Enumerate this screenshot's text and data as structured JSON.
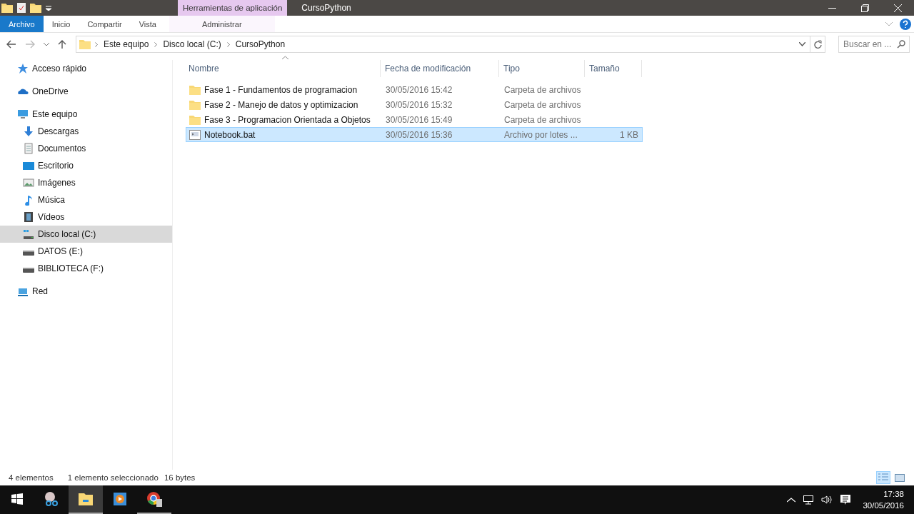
{
  "title_bar": {
    "contextual_tab": "Herramientas de aplicación",
    "title": "CursoPython"
  },
  "ribbon_tabs": [
    {
      "label": "Archivo",
      "kind": "file"
    },
    {
      "label": "Inicio",
      "kind": "normal"
    },
    {
      "label": "Compartir",
      "kind": "normal"
    },
    {
      "label": "Vista",
      "kind": "normal"
    },
    {
      "label": "Administrar",
      "kind": "contextual"
    }
  ],
  "address_bar": {
    "breadcrumbs": [
      "Este equipo",
      "Disco local (C:)",
      "CursoPython"
    ]
  },
  "search": {
    "placeholder": "Buscar en ..."
  },
  "sidebar": {
    "items": [
      {
        "label": "Acceso rápido",
        "kind": "star",
        "selected": false
      },
      {
        "label": "OneDrive",
        "kind": "cloud",
        "selected": false
      },
      {
        "label": "Este equipo",
        "kind": "pc",
        "selected": false,
        "children": [
          {
            "label": "Descargas",
            "kind": "download",
            "selected": false
          },
          {
            "label": "Documentos",
            "kind": "document",
            "selected": false
          },
          {
            "label": "Escritorio",
            "kind": "desktop",
            "selected": false
          },
          {
            "label": "Imágenes",
            "kind": "image",
            "selected": false
          },
          {
            "label": "Música",
            "kind": "music",
            "selected": false
          },
          {
            "label": "Vídeos",
            "kind": "video",
            "selected": false
          },
          {
            "label": "Disco local (C:)",
            "kind": "windrive",
            "selected": true
          },
          {
            "label": "DATOS (E:)",
            "kind": "drive",
            "selected": false
          },
          {
            "label": "BIBLIOTECA (F:)",
            "kind": "drive",
            "selected": false
          }
        ]
      },
      {
        "label": "Red",
        "kind": "network",
        "selected": false
      }
    ]
  },
  "table": {
    "columns": [
      {
        "label": "Nombre",
        "sorted": true
      },
      {
        "label": "Fecha de modificación",
        "sorted": false
      },
      {
        "label": "Tipo",
        "sorted": false
      },
      {
        "label": "Tamaño",
        "sorted": false
      }
    ],
    "rows": [
      {
        "name": "Fase 1 - Fundamentos de programacion",
        "date": "30/05/2016 15:42",
        "type": "Carpeta de archivos",
        "kind": "folder",
        "selected": false
      },
      {
        "name": "Fase 2 - Manejo de datos y optimizacion",
        "date": "30/05/2016 15:32",
        "type": "Carpeta de archivos",
        "kind": "folder",
        "selected": false
      },
      {
        "name": "Fase 3 - Programacion Orientada a Objetos",
        "date": "30/05/2016 15:49",
        "type": "Carpeta de archivos",
        "kind": "folder",
        "selected": false
      },
      {
        "name": "Notebook.bat",
        "date": "30/05/2016 15:36",
        "type": "Archivo por lotes ...",
        "size": "1 KB",
        "kind": "file",
        "selected": true
      }
    ]
  },
  "status_bar": {
    "count": "4 elementos",
    "selection": "1 elemento seleccionado",
    "size": "16 bytes"
  },
  "taskbar": {
    "apps": [
      {
        "kind": "snip",
        "selected": false,
        "running": false
      },
      {
        "kind": "explorer",
        "selected": true,
        "running": true
      },
      {
        "kind": "player",
        "selected": false,
        "running": false
      },
      {
        "kind": "chrome",
        "selected": false,
        "running": true
      }
    ],
    "time": "17:38",
    "date": "30/05/2016"
  }
}
